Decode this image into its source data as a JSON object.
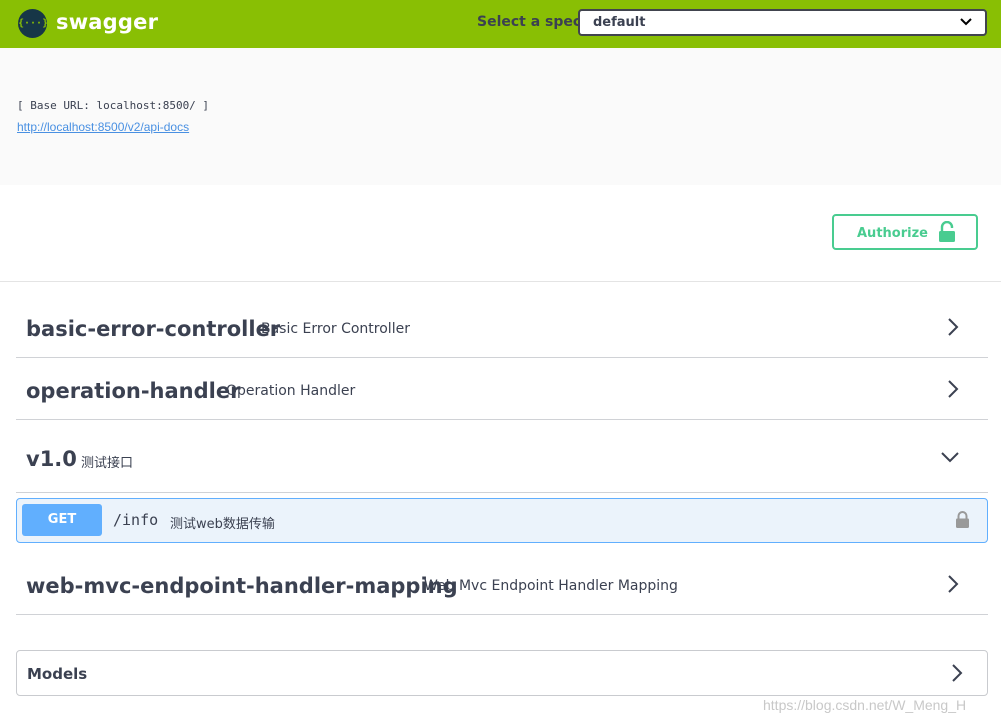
{
  "topbar": {
    "logo_glyph": "{···}",
    "brand": "swagger",
    "spec_label": "Select a spec",
    "spec_value": "default",
    "background": "#89bf04"
  },
  "info": {
    "base_url": "[ Base URL: localhost:8500/ ]",
    "api_docs_link": "http://localhost:8500/v2/api-docs"
  },
  "authorize": {
    "label": "Authorize",
    "icon": "unlock-icon",
    "color": "#49cc90"
  },
  "tags": [
    {
      "name": "basic-error-controller",
      "description": "Basic Error Controller",
      "expanded": false
    },
    {
      "name": "operation-handler",
      "description": "Operation Handler",
      "expanded": false
    },
    {
      "name": "v1.0",
      "description": "测试接口",
      "expanded": true
    },
    {
      "name": "web-mvc-endpoint-handler-mapping",
      "description": "Web Mvc Endpoint Handler Mapping",
      "expanded": false
    }
  ],
  "operation": {
    "method": "GET",
    "path": "/info",
    "summary": "测试web数据传输",
    "method_color": "#61affe",
    "icon": "lock-icon"
  },
  "models": {
    "title": "Models"
  },
  "watermark": "https://blog.csdn.net/W_Meng_H"
}
